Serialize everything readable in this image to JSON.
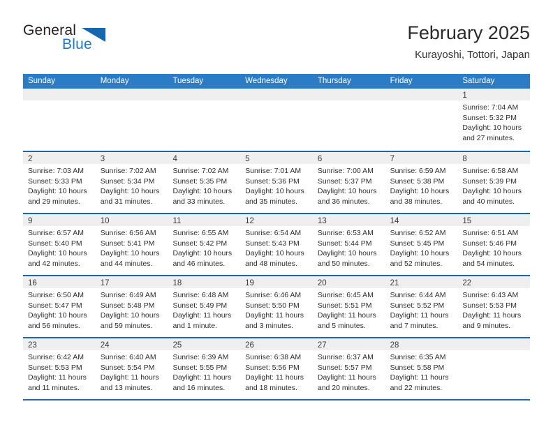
{
  "brand": {
    "word_one": "General",
    "word_two": "Blue",
    "accent_color": "#1567b2",
    "text_color": "#231f20"
  },
  "header": {
    "title": "February 2025",
    "subtitle": "Kurayoshi, Tottori, Japan"
  },
  "calendar": {
    "header_bg": "#2b7cc4",
    "row_divider": "#1768b0",
    "day_band_bg": "#efefef",
    "weekdays": [
      "Sunday",
      "Monday",
      "Tuesday",
      "Wednesday",
      "Thursday",
      "Friday",
      "Saturday"
    ],
    "weeks": [
      [
        {
          "day": "",
          "lines": []
        },
        {
          "day": "",
          "lines": []
        },
        {
          "day": "",
          "lines": []
        },
        {
          "day": "",
          "lines": []
        },
        {
          "day": "",
          "lines": []
        },
        {
          "day": "",
          "lines": []
        },
        {
          "day": "1",
          "lines": [
            "Sunrise: 7:04 AM",
            "Sunset: 5:32 PM",
            "Daylight: 10 hours",
            "and 27 minutes."
          ]
        }
      ],
      [
        {
          "day": "2",
          "lines": [
            "Sunrise: 7:03 AM",
            "Sunset: 5:33 PM",
            "Daylight: 10 hours",
            "and 29 minutes."
          ]
        },
        {
          "day": "3",
          "lines": [
            "Sunrise: 7:02 AM",
            "Sunset: 5:34 PM",
            "Daylight: 10 hours",
            "and 31 minutes."
          ]
        },
        {
          "day": "4",
          "lines": [
            "Sunrise: 7:02 AM",
            "Sunset: 5:35 PM",
            "Daylight: 10 hours",
            "and 33 minutes."
          ]
        },
        {
          "day": "5",
          "lines": [
            "Sunrise: 7:01 AM",
            "Sunset: 5:36 PM",
            "Daylight: 10 hours",
            "and 35 minutes."
          ]
        },
        {
          "day": "6",
          "lines": [
            "Sunrise: 7:00 AM",
            "Sunset: 5:37 PM",
            "Daylight: 10 hours",
            "and 36 minutes."
          ]
        },
        {
          "day": "7",
          "lines": [
            "Sunrise: 6:59 AM",
            "Sunset: 5:38 PM",
            "Daylight: 10 hours",
            "and 38 minutes."
          ]
        },
        {
          "day": "8",
          "lines": [
            "Sunrise: 6:58 AM",
            "Sunset: 5:39 PM",
            "Daylight: 10 hours",
            "and 40 minutes."
          ]
        }
      ],
      [
        {
          "day": "9",
          "lines": [
            "Sunrise: 6:57 AM",
            "Sunset: 5:40 PM",
            "Daylight: 10 hours",
            "and 42 minutes."
          ]
        },
        {
          "day": "10",
          "lines": [
            "Sunrise: 6:56 AM",
            "Sunset: 5:41 PM",
            "Daylight: 10 hours",
            "and 44 minutes."
          ]
        },
        {
          "day": "11",
          "lines": [
            "Sunrise: 6:55 AM",
            "Sunset: 5:42 PM",
            "Daylight: 10 hours",
            "and 46 minutes."
          ]
        },
        {
          "day": "12",
          "lines": [
            "Sunrise: 6:54 AM",
            "Sunset: 5:43 PM",
            "Daylight: 10 hours",
            "and 48 minutes."
          ]
        },
        {
          "day": "13",
          "lines": [
            "Sunrise: 6:53 AM",
            "Sunset: 5:44 PM",
            "Daylight: 10 hours",
            "and 50 minutes."
          ]
        },
        {
          "day": "14",
          "lines": [
            "Sunrise: 6:52 AM",
            "Sunset: 5:45 PM",
            "Daylight: 10 hours",
            "and 52 minutes."
          ]
        },
        {
          "day": "15",
          "lines": [
            "Sunrise: 6:51 AM",
            "Sunset: 5:46 PM",
            "Daylight: 10 hours",
            "and 54 minutes."
          ]
        }
      ],
      [
        {
          "day": "16",
          "lines": [
            "Sunrise: 6:50 AM",
            "Sunset: 5:47 PM",
            "Daylight: 10 hours",
            "and 56 minutes."
          ]
        },
        {
          "day": "17",
          "lines": [
            "Sunrise: 6:49 AM",
            "Sunset: 5:48 PM",
            "Daylight: 10 hours",
            "and 59 minutes."
          ]
        },
        {
          "day": "18",
          "lines": [
            "Sunrise: 6:48 AM",
            "Sunset: 5:49 PM",
            "Daylight: 11 hours",
            "and 1 minute."
          ]
        },
        {
          "day": "19",
          "lines": [
            "Sunrise: 6:46 AM",
            "Sunset: 5:50 PM",
            "Daylight: 11 hours",
            "and 3 minutes."
          ]
        },
        {
          "day": "20",
          "lines": [
            "Sunrise: 6:45 AM",
            "Sunset: 5:51 PM",
            "Daylight: 11 hours",
            "and 5 minutes."
          ]
        },
        {
          "day": "21",
          "lines": [
            "Sunrise: 6:44 AM",
            "Sunset: 5:52 PM",
            "Daylight: 11 hours",
            "and 7 minutes."
          ]
        },
        {
          "day": "22",
          "lines": [
            "Sunrise: 6:43 AM",
            "Sunset: 5:53 PM",
            "Daylight: 11 hours",
            "and 9 minutes."
          ]
        }
      ],
      [
        {
          "day": "23",
          "lines": [
            "Sunrise: 6:42 AM",
            "Sunset: 5:53 PM",
            "Daylight: 11 hours",
            "and 11 minutes."
          ]
        },
        {
          "day": "24",
          "lines": [
            "Sunrise: 6:40 AM",
            "Sunset: 5:54 PM",
            "Daylight: 11 hours",
            "and 13 minutes."
          ]
        },
        {
          "day": "25",
          "lines": [
            "Sunrise: 6:39 AM",
            "Sunset: 5:55 PM",
            "Daylight: 11 hours",
            "and 16 minutes."
          ]
        },
        {
          "day": "26",
          "lines": [
            "Sunrise: 6:38 AM",
            "Sunset: 5:56 PM",
            "Daylight: 11 hours",
            "and 18 minutes."
          ]
        },
        {
          "day": "27",
          "lines": [
            "Sunrise: 6:37 AM",
            "Sunset: 5:57 PM",
            "Daylight: 11 hours",
            "and 20 minutes."
          ]
        },
        {
          "day": "28",
          "lines": [
            "Sunrise: 6:35 AM",
            "Sunset: 5:58 PM",
            "Daylight: 11 hours",
            "and 22 minutes."
          ]
        },
        {
          "day": "",
          "lines": []
        }
      ]
    ]
  }
}
